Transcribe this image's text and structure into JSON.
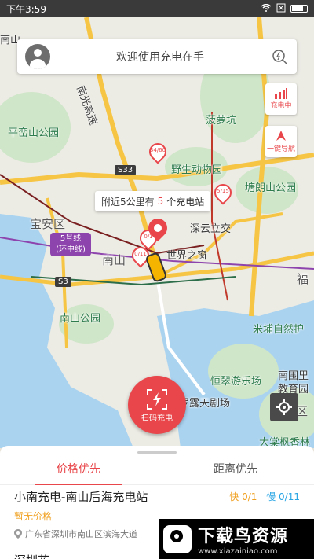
{
  "status_bar": {
    "time": "下午3:59",
    "icons": [
      "wifi-icon",
      "sim-icon",
      "battery-icon"
    ]
  },
  "search": {
    "text": "欢迎使用充电在手"
  },
  "side_buttons": [
    {
      "label": "充电中",
      "icon": "charging-bars-icon"
    },
    {
      "label": "一键导航",
      "icon": "navigation-icon"
    }
  ],
  "nearby": {
    "prefix": "附近5公里有",
    "count": "5",
    "suffix": "个充电站"
  },
  "map": {
    "labels": {
      "nanshan_park_top": "南山",
      "pingzhou_park": "平峦山公园",
      "nanguang": "南光高速",
      "bobaogu": "菠萝坑",
      "safari": "野生动物园",
      "tanglang": "塘朗山公园",
      "baoan": "宝安区",
      "shenzhen_window": "世界之窗",
      "shenyun": "深云立交",
      "nanshan_mid": "南山",
      "nanshan_park": "南山公园",
      "mibu": "米埔自然护",
      "hengcui": "恒翠游乐场",
      "luolu": "罗露天剧场",
      "nanwei": "南围里",
      "edu": "教育园",
      "dameisha": "大棠枫香林",
      "fu": "福",
      "yuan_district": "元区",
      "s33": "S33",
      "s3": "S3"
    },
    "metro_badge": "5号线\n(环中线)",
    "pins": [
      "34/60",
      "5/15",
      "0/11",
      "0/1"
    ]
  },
  "scan": {
    "label": "扫码充电"
  },
  "sheet": {
    "tabs": [
      "价格优先",
      "距离优先"
    ],
    "active_tab": 0,
    "station": {
      "name": "小南充电-南山后海充电站",
      "fast": "快 0/1",
      "slow": "慢 0/11",
      "price": "暂无价格",
      "address": "广东省深圳市南山区滨海大道"
    },
    "next_station_partial": "深圳花..."
  },
  "watermark": {
    "big": "下载鸟资源",
    "small": "www.xiazainiao.com"
  },
  "colors": {
    "accent": "#e8464a",
    "fast": "#f0a020",
    "slow": "#29a5e4"
  }
}
